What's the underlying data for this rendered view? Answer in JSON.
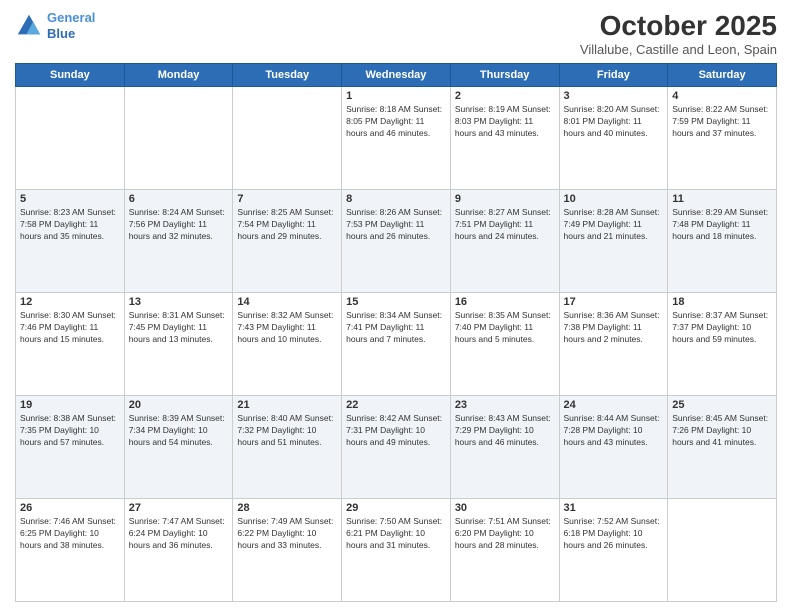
{
  "header": {
    "logo_line1": "General",
    "logo_line2": "Blue",
    "month_title": "October 2025",
    "location": "Villalube, Castille and Leon, Spain"
  },
  "days_of_week": [
    "Sunday",
    "Monday",
    "Tuesday",
    "Wednesday",
    "Thursday",
    "Friday",
    "Saturday"
  ],
  "weeks": [
    [
      {
        "day": "",
        "info": ""
      },
      {
        "day": "",
        "info": ""
      },
      {
        "day": "",
        "info": ""
      },
      {
        "day": "1",
        "info": "Sunrise: 8:18 AM\nSunset: 8:05 PM\nDaylight: 11 hours and 46 minutes."
      },
      {
        "day": "2",
        "info": "Sunrise: 8:19 AM\nSunset: 8:03 PM\nDaylight: 11 hours and 43 minutes."
      },
      {
        "day": "3",
        "info": "Sunrise: 8:20 AM\nSunset: 8:01 PM\nDaylight: 11 hours and 40 minutes."
      },
      {
        "day": "4",
        "info": "Sunrise: 8:22 AM\nSunset: 7:59 PM\nDaylight: 11 hours and 37 minutes."
      }
    ],
    [
      {
        "day": "5",
        "info": "Sunrise: 8:23 AM\nSunset: 7:58 PM\nDaylight: 11 hours and 35 minutes."
      },
      {
        "day": "6",
        "info": "Sunrise: 8:24 AM\nSunset: 7:56 PM\nDaylight: 11 hours and 32 minutes."
      },
      {
        "day": "7",
        "info": "Sunrise: 8:25 AM\nSunset: 7:54 PM\nDaylight: 11 hours and 29 minutes."
      },
      {
        "day": "8",
        "info": "Sunrise: 8:26 AM\nSunset: 7:53 PM\nDaylight: 11 hours and 26 minutes."
      },
      {
        "day": "9",
        "info": "Sunrise: 8:27 AM\nSunset: 7:51 PM\nDaylight: 11 hours and 24 minutes."
      },
      {
        "day": "10",
        "info": "Sunrise: 8:28 AM\nSunset: 7:49 PM\nDaylight: 11 hours and 21 minutes."
      },
      {
        "day": "11",
        "info": "Sunrise: 8:29 AM\nSunset: 7:48 PM\nDaylight: 11 hours and 18 minutes."
      }
    ],
    [
      {
        "day": "12",
        "info": "Sunrise: 8:30 AM\nSunset: 7:46 PM\nDaylight: 11 hours and 15 minutes."
      },
      {
        "day": "13",
        "info": "Sunrise: 8:31 AM\nSunset: 7:45 PM\nDaylight: 11 hours and 13 minutes."
      },
      {
        "day": "14",
        "info": "Sunrise: 8:32 AM\nSunset: 7:43 PM\nDaylight: 11 hours and 10 minutes."
      },
      {
        "day": "15",
        "info": "Sunrise: 8:34 AM\nSunset: 7:41 PM\nDaylight: 11 hours and 7 minutes."
      },
      {
        "day": "16",
        "info": "Sunrise: 8:35 AM\nSunset: 7:40 PM\nDaylight: 11 hours and 5 minutes."
      },
      {
        "day": "17",
        "info": "Sunrise: 8:36 AM\nSunset: 7:38 PM\nDaylight: 11 hours and 2 minutes."
      },
      {
        "day": "18",
        "info": "Sunrise: 8:37 AM\nSunset: 7:37 PM\nDaylight: 10 hours and 59 minutes."
      }
    ],
    [
      {
        "day": "19",
        "info": "Sunrise: 8:38 AM\nSunset: 7:35 PM\nDaylight: 10 hours and 57 minutes."
      },
      {
        "day": "20",
        "info": "Sunrise: 8:39 AM\nSunset: 7:34 PM\nDaylight: 10 hours and 54 minutes."
      },
      {
        "day": "21",
        "info": "Sunrise: 8:40 AM\nSunset: 7:32 PM\nDaylight: 10 hours and 51 minutes."
      },
      {
        "day": "22",
        "info": "Sunrise: 8:42 AM\nSunset: 7:31 PM\nDaylight: 10 hours and 49 minutes."
      },
      {
        "day": "23",
        "info": "Sunrise: 8:43 AM\nSunset: 7:29 PM\nDaylight: 10 hours and 46 minutes."
      },
      {
        "day": "24",
        "info": "Sunrise: 8:44 AM\nSunset: 7:28 PM\nDaylight: 10 hours and 43 minutes."
      },
      {
        "day": "25",
        "info": "Sunrise: 8:45 AM\nSunset: 7:26 PM\nDaylight: 10 hours and 41 minutes."
      }
    ],
    [
      {
        "day": "26",
        "info": "Sunrise: 7:46 AM\nSunset: 6:25 PM\nDaylight: 10 hours and 38 minutes."
      },
      {
        "day": "27",
        "info": "Sunrise: 7:47 AM\nSunset: 6:24 PM\nDaylight: 10 hours and 36 minutes."
      },
      {
        "day": "28",
        "info": "Sunrise: 7:49 AM\nSunset: 6:22 PM\nDaylight: 10 hours and 33 minutes."
      },
      {
        "day": "29",
        "info": "Sunrise: 7:50 AM\nSunset: 6:21 PM\nDaylight: 10 hours and 31 minutes."
      },
      {
        "day": "30",
        "info": "Sunrise: 7:51 AM\nSunset: 6:20 PM\nDaylight: 10 hours and 28 minutes."
      },
      {
        "day": "31",
        "info": "Sunrise: 7:52 AM\nSunset: 6:18 PM\nDaylight: 10 hours and 26 minutes."
      },
      {
        "day": "",
        "info": ""
      }
    ]
  ]
}
